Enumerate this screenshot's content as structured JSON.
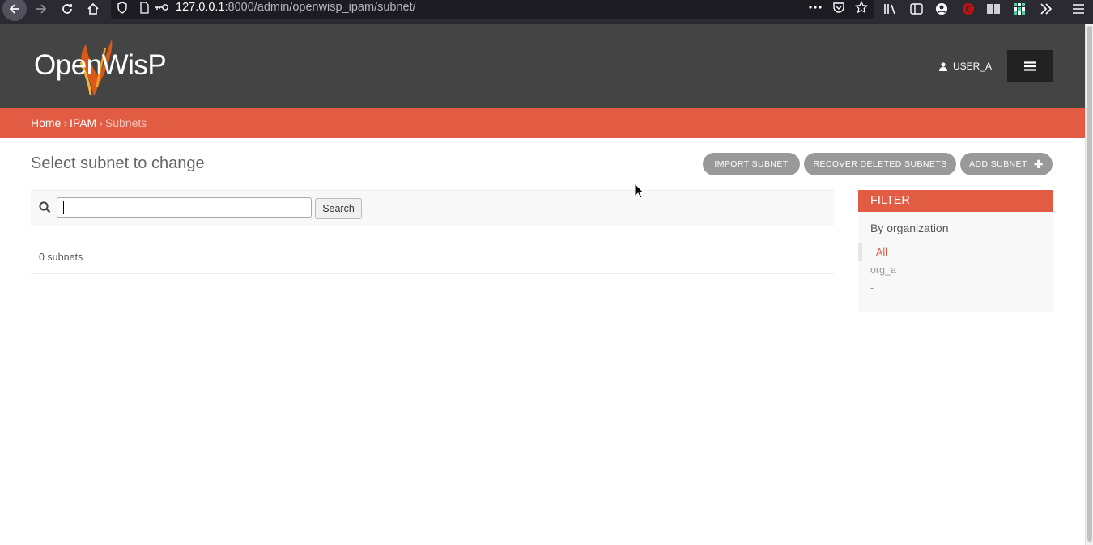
{
  "browser": {
    "url_host": "127.0.0.1",
    "url_rest": ":8000/admin/openwisp_ipam/subnet/"
  },
  "header": {
    "logo_text": "OpenWisP",
    "user": "USER_A"
  },
  "breadcrumbs": {
    "home": "Home",
    "ipam": "IPAM",
    "current": "Subnets",
    "separator": "›"
  },
  "main": {
    "title": "Select subnet to change",
    "tools": {
      "import": "IMPORT SUBNET",
      "recover": "RECOVER DELETED SUBNETS",
      "add": "ADD SUBNET"
    },
    "search": {
      "value": "",
      "button": "Search"
    },
    "result_count": "0 subnets"
  },
  "filter": {
    "title": "FILTER",
    "heading": "By organization",
    "items": [
      "All",
      "org_a",
      "-"
    ]
  },
  "colors": {
    "accent": "#e15c43",
    "header_bg": "#444444",
    "button_grey": "#999999"
  }
}
